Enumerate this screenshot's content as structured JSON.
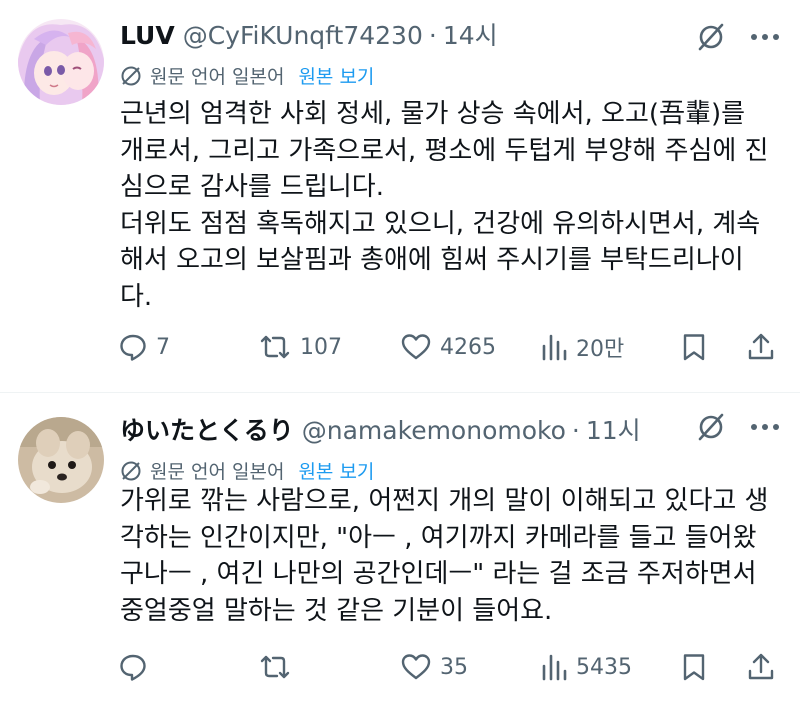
{
  "posts": [
    {
      "display_name": "LUV",
      "handle": "@CyFiKUnqft74230",
      "separator": "·",
      "time": "14시",
      "translation": {
        "language_label": "원문 언어 일본어",
        "show_original": "원본 보기"
      },
      "text_lines": [
        "근년의 엄격한 사회 정세, 물가 상승 속에서, 오고(吾輩)를",
        "개로서, 그리고 가족으로서, 평소에 두텁게 부양해 주심에 진",
        "심으로 감사를 드립니다.",
        "더위도 점점 혹독해지고 있으니, 건강에 유의하시면서, 계속",
        "해서 오고의 보살핌과 총애에 힘써 주시기를 부탁드리나이",
        "다."
      ],
      "stats": {
        "replies": "7",
        "reposts": "107",
        "likes": "4265",
        "views": "20만"
      }
    },
    {
      "display_name": "ゆいたとくるり",
      "handle": "@namakemonomoko",
      "separator": "·",
      "time": "11시",
      "translation": {
        "language_label": "원문 언어 일본어",
        "show_original": "원본 보기"
      },
      "text_lines": [
        "가위로 깎는 사람으로, 어쩐지 개의 말이 이해되고 있다고 생",
        "각하는 인간이지만, \"아ㅡ , 여기까지 카메라를 들고 들어왔",
        "구나ㅡ , 여긴 나만의 공간인데ㅡ\" 라는 걸 조금 주저하면서",
        "중얼중얼 말하는 것 같은 기분이 들어요."
      ],
      "stats": {
        "replies": "",
        "reposts": "",
        "likes": "35",
        "views": "5435"
      }
    }
  ],
  "icons": {
    "reply": "reply-icon",
    "repost": "repost-icon",
    "like": "heart-icon",
    "views": "views-icon",
    "bookmark": "bookmark-icon",
    "share": "share-icon",
    "grok": "grok-icon",
    "more": "more-icon",
    "translate": "globe-icon"
  },
  "colors": {
    "text": "#0f1419",
    "secondary": "#536471",
    "link": "#1d9bf0",
    "divider": "#eff3f4"
  }
}
